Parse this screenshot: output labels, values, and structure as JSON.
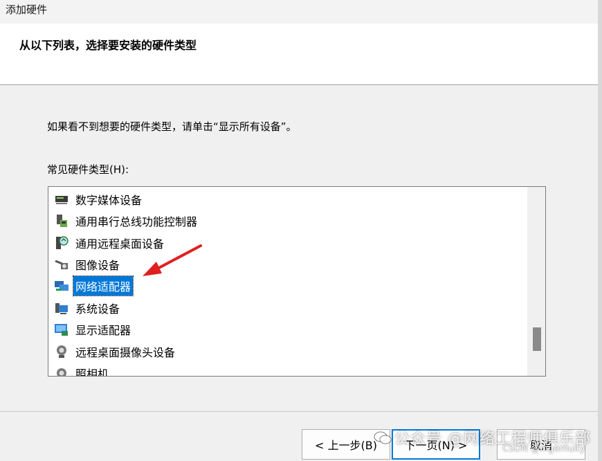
{
  "window": {
    "title": "添加硬件"
  },
  "header": {
    "heading": "从以下列表，选择要安装的硬件类型"
  },
  "instruction": "如果看不到想要的硬件类型，请单击“显示所有设备”。",
  "list": {
    "label": "常见硬件类型(H):",
    "items": [
      {
        "label": "数字媒体设备",
        "icon": "media-device-icon",
        "selected": false
      },
      {
        "label": "通用串行总线功能控制器",
        "icon": "usb-controller-icon",
        "selected": false
      },
      {
        "label": "通用远程桌面设备",
        "icon": "remote-desktop-device-icon",
        "selected": false
      },
      {
        "label": "图像设备",
        "icon": "camera-icon",
        "selected": false
      },
      {
        "label": "网络适配器",
        "icon": "network-adapter-icon",
        "selected": true
      },
      {
        "label": "系统设备",
        "icon": "system-device-icon",
        "selected": false
      },
      {
        "label": "显示适配器",
        "icon": "display-adapter-icon",
        "selected": false
      },
      {
        "label": "远程桌面摄像头设备",
        "icon": "webcam-icon",
        "selected": false
      },
      {
        "label": "照相机",
        "icon": "camera-device-icon",
        "selected": false
      }
    ],
    "scroll_position": 0.85
  },
  "buttons": {
    "back": "< 上一步(B)",
    "next": "下一页(N) >",
    "cancel": "取消"
  },
  "watermark": {
    "main": "公众号 @网络工程师俱乐部",
    "csdn": "CSDN @ingemuity"
  },
  "colors": {
    "selection": "#0078d7",
    "annotation_arrow": "#e02020"
  }
}
